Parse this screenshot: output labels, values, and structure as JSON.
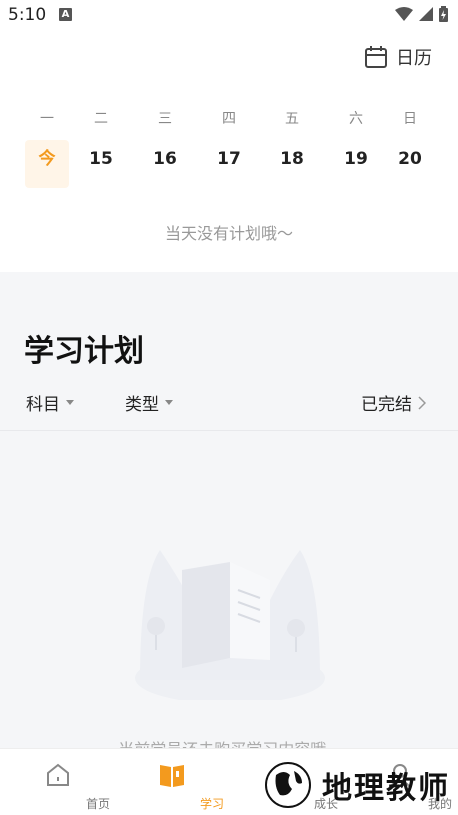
{
  "status": {
    "time": "5:10",
    "notif_badge": "A"
  },
  "calendar": {
    "button_label": "日历",
    "weekdays": [
      "一",
      "二",
      "三",
      "四",
      "五",
      "六",
      "日"
    ],
    "dates": [
      "今",
      "15",
      "16",
      "17",
      "18",
      "19",
      "20"
    ],
    "empty_message": "当天没有计划哦～"
  },
  "plan": {
    "title": "学习计划",
    "filters": {
      "subject": "科目",
      "type": "类型",
      "completed": "已完结"
    },
    "empty_message": "当前学员还未购买学习内容哦~"
  },
  "nav": {
    "items": [
      {
        "label": "首页"
      },
      {
        "label": "学习"
      },
      {
        "label": "成长"
      },
      {
        "label": "我的"
      }
    ]
  },
  "watermark": {
    "text": "地理教师"
  },
  "colors": {
    "accent": "#f39a1e",
    "bg_gray": "#f5f6f8"
  }
}
